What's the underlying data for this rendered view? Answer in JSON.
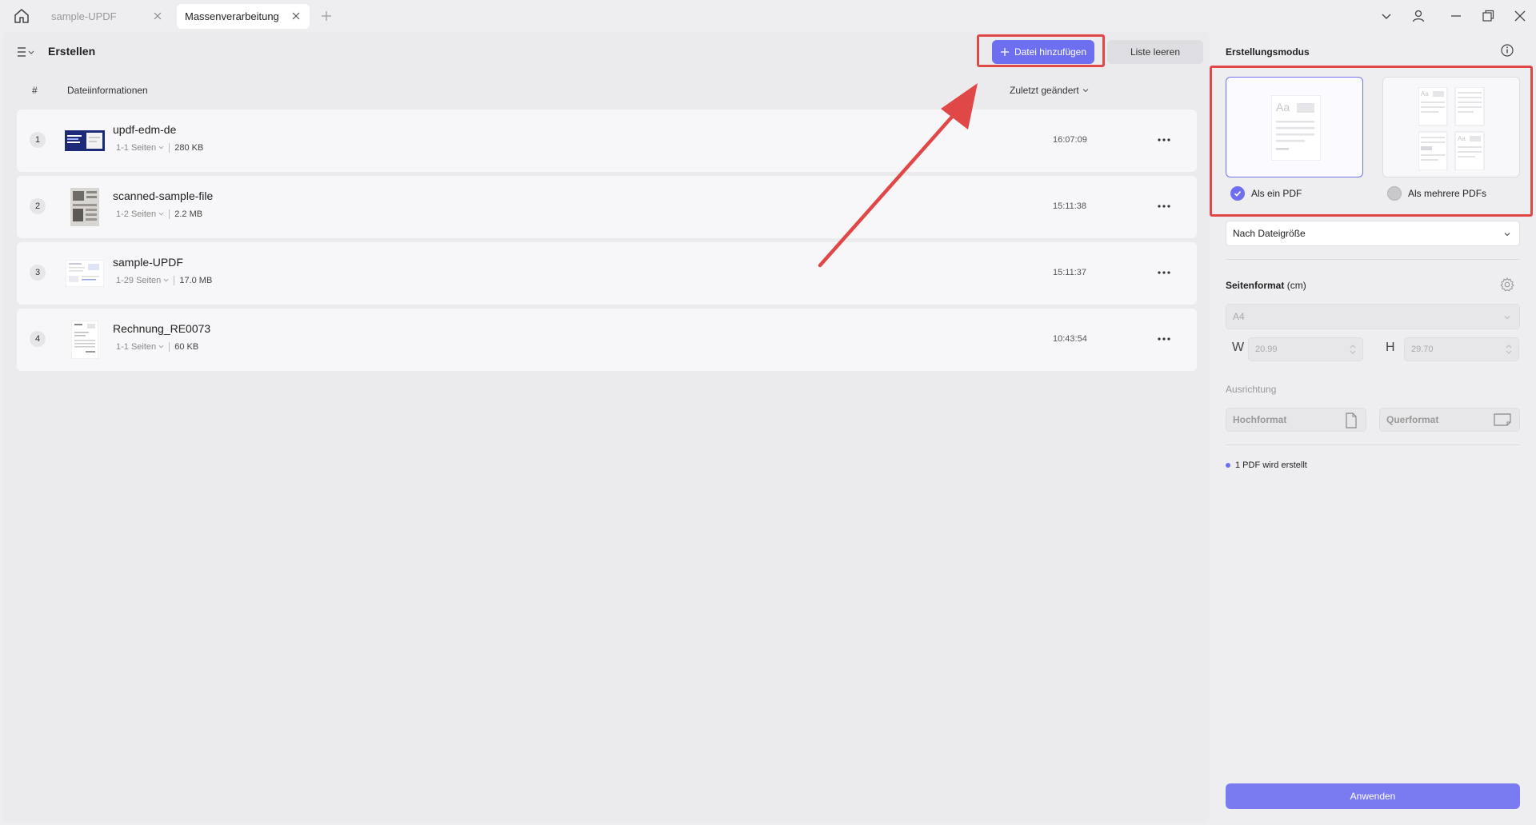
{
  "tabs": [
    {
      "label": "sample-UPDF",
      "active": false
    },
    {
      "label": "Massenverarbeitung",
      "active": true
    }
  ],
  "toolbar": {
    "title": "Erstellen",
    "add_label": "Datei hinzufügen",
    "clear_label": "Liste leeren"
  },
  "columns": {
    "number": "#",
    "info": "Dateiinformationen",
    "modified": "Zuletzt geändert"
  },
  "files": [
    {
      "num": "1",
      "name": "updf-edm-de",
      "pages": "1-1 Seiten",
      "size": "280 KB",
      "time": "16:07:09"
    },
    {
      "num": "2",
      "name": "scanned-sample-file",
      "pages": "1-2 Seiten",
      "size": "2.2 MB",
      "time": "15:11:38"
    },
    {
      "num": "3",
      "name": "sample-UPDF",
      "pages": "1-29 Seiten",
      "size": "17.0 MB",
      "time": "15:11:37"
    },
    {
      "num": "4",
      "name": "Rechnung_RE0073",
      "pages": "1-1 Seiten",
      "size": "60 KB",
      "time": "10:43:54"
    }
  ],
  "panel": {
    "title": "Erstellungsmodus",
    "mode_single": "Als ein PDF",
    "mode_multi": "Als mehrere PDFs",
    "selected_mode": "single",
    "sort_select": "Nach Dateigröße",
    "page_format_label": "Seitenformat",
    "page_format_unit": "(cm)",
    "format_select": "A4",
    "width_letter": "W",
    "width_value": "20.99",
    "height_letter": "H",
    "height_value": "29.70",
    "orientation_label": "Ausrichtung",
    "portrait": "Hochformat",
    "landscape": "Querformat",
    "status": "1 PDF wird erstellt",
    "apply": "Anwenden"
  },
  "colors": {
    "accent": "#6e6ef0",
    "annotation": "#e04848"
  }
}
